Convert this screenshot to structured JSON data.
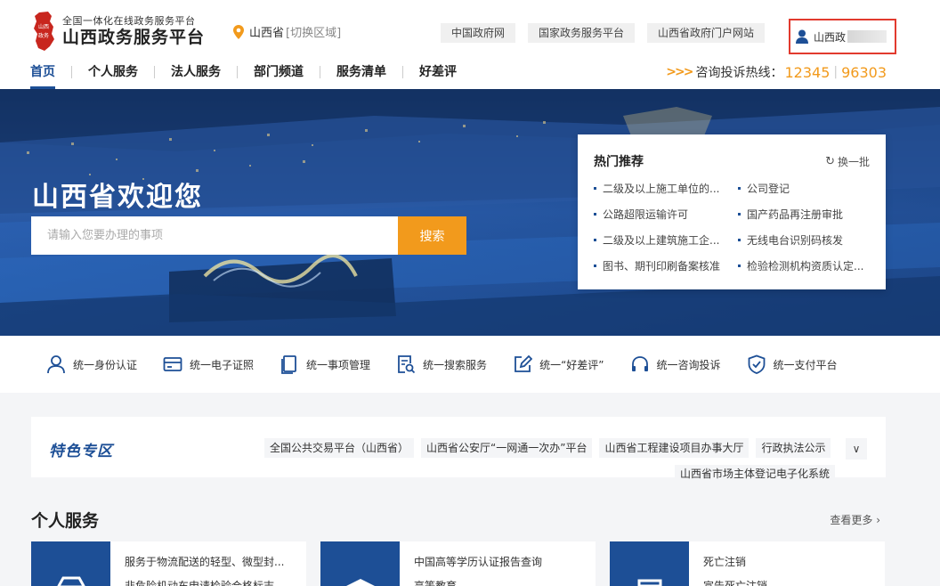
{
  "header": {
    "logo_sub": "全国一体化在线政务服务平台",
    "logo_main": "山西政务服务平台",
    "region_name": "山西省",
    "region_switch": "[切换区域]",
    "top_links": [
      "中国政府网",
      "国家政务服务平台",
      "山西省政府门户网站"
    ],
    "user_name": "山西政",
    "nav": [
      "首页",
      "个人服务",
      "法人服务",
      "部门频道",
      "服务清单",
      "好差评"
    ],
    "hotline_label": "咨询投诉热线：",
    "hotline_1": "12345",
    "hotline_2": "96303",
    "hotline_arrows": ">>>"
  },
  "banner": {
    "welcome": "山西省欢迎您",
    "search_placeholder": "请输入您要办理的事项",
    "search_button": "搜索"
  },
  "hot": {
    "title": "热门推荐",
    "refresh": "换一批",
    "refresh_icon": "↻",
    "items": [
      "二级及以上施工单位的...",
      "公司登记",
      "公路超限运输许可",
      "国产药品再注册审批",
      "二级及以上建筑施工企...",
      "无线电台识别码核发",
      "图书、期刊印刷备案核准",
      "检验检测机构资质认定..."
    ]
  },
  "features": [
    {
      "label": "统一身份认证",
      "icon": "user-icon"
    },
    {
      "label": "统一电子证照",
      "icon": "card-icon"
    },
    {
      "label": "统一事项管理",
      "icon": "document-icon"
    },
    {
      "label": "统一搜索服务",
      "icon": "search-doc-icon"
    },
    {
      "label": "统一“好差评”",
      "icon": "edit-icon"
    },
    {
      "label": "统一咨询投诉",
      "icon": "headset-icon"
    },
    {
      "label": "统一支付平台",
      "icon": "shield-check-icon"
    }
  ],
  "special": {
    "title": "特色专区",
    "links": [
      "全国公共交易平台（山西省）",
      "山西省公安厅“一网通一次办”平台",
      "山西省工程建设项目办事大厅",
      "行政执法公示"
    ],
    "extra": "山西省市场主体登记电子化系统",
    "more_icon": "∨"
  },
  "personal": {
    "title": "个人服务",
    "more": "查看更多",
    "more_icon": "›",
    "cards": [
      {
        "t1": "服务于物流配送的轻型、微型封...",
        "t2": "非危险机动车申请检验合格标志"
      },
      {
        "t1": "中国高等学历认证报告查询",
        "t2": "高等教育"
      },
      {
        "t1": "死亡注销",
        "t2": "宣告死亡注销"
      }
    ]
  },
  "colors": {
    "brand_blue": "#1d4f96",
    "accent_orange": "#f29a1c",
    "highlight_red": "#e23a2e"
  }
}
